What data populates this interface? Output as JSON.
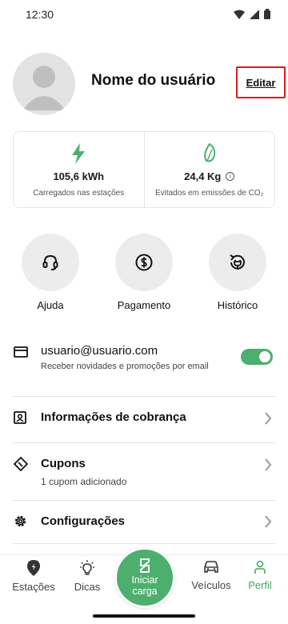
{
  "status_bar": {
    "time": "12:30"
  },
  "profile": {
    "name": "Nome do usuário",
    "edit_label": "Editar"
  },
  "stats": [
    {
      "value": "105,6 kWh",
      "label": "Carregados nas estações",
      "icon": "lightning-icon"
    },
    {
      "value": "24,4 Kg",
      "label": "Evitados em emissões de CO₂",
      "icon": "leaf-icon"
    }
  ],
  "actions": [
    {
      "label": "Ajuda",
      "icon": "headset-icon"
    },
    {
      "label": "Pagamento",
      "icon": "dollar-icon"
    },
    {
      "label": "Histórico",
      "icon": "charge-history-icon"
    }
  ],
  "email_row": {
    "email": "usuario@usuario.com",
    "subtitle": "Receber novidades e promoções por email",
    "toggle_on": true
  },
  "menu": [
    {
      "title": "Informações de cobrança",
      "subtitle": "",
      "icon": "id-card-icon"
    },
    {
      "title": "Cupons",
      "subtitle": "1 cupom adicionado",
      "icon": "ticket-icon"
    },
    {
      "title": "Configurações",
      "subtitle": "",
      "icon": "gear-icon"
    }
  ],
  "bottom_nav": {
    "items": [
      {
        "label": "Estações",
        "icon": "location-pin-icon",
        "active": false
      },
      {
        "label": "Dicas",
        "icon": "lightbulb-icon",
        "active": false
      },
      {
        "label": "Veículos",
        "icon": "car-icon",
        "active": false
      },
      {
        "label": "Perfil",
        "icon": "person-icon",
        "active": true
      }
    ],
    "fab_line1": "Iniciar",
    "fab_line2": "carga"
  },
  "colors": {
    "accent": "#4caf6e",
    "highlight_border": "#e01b1b"
  }
}
